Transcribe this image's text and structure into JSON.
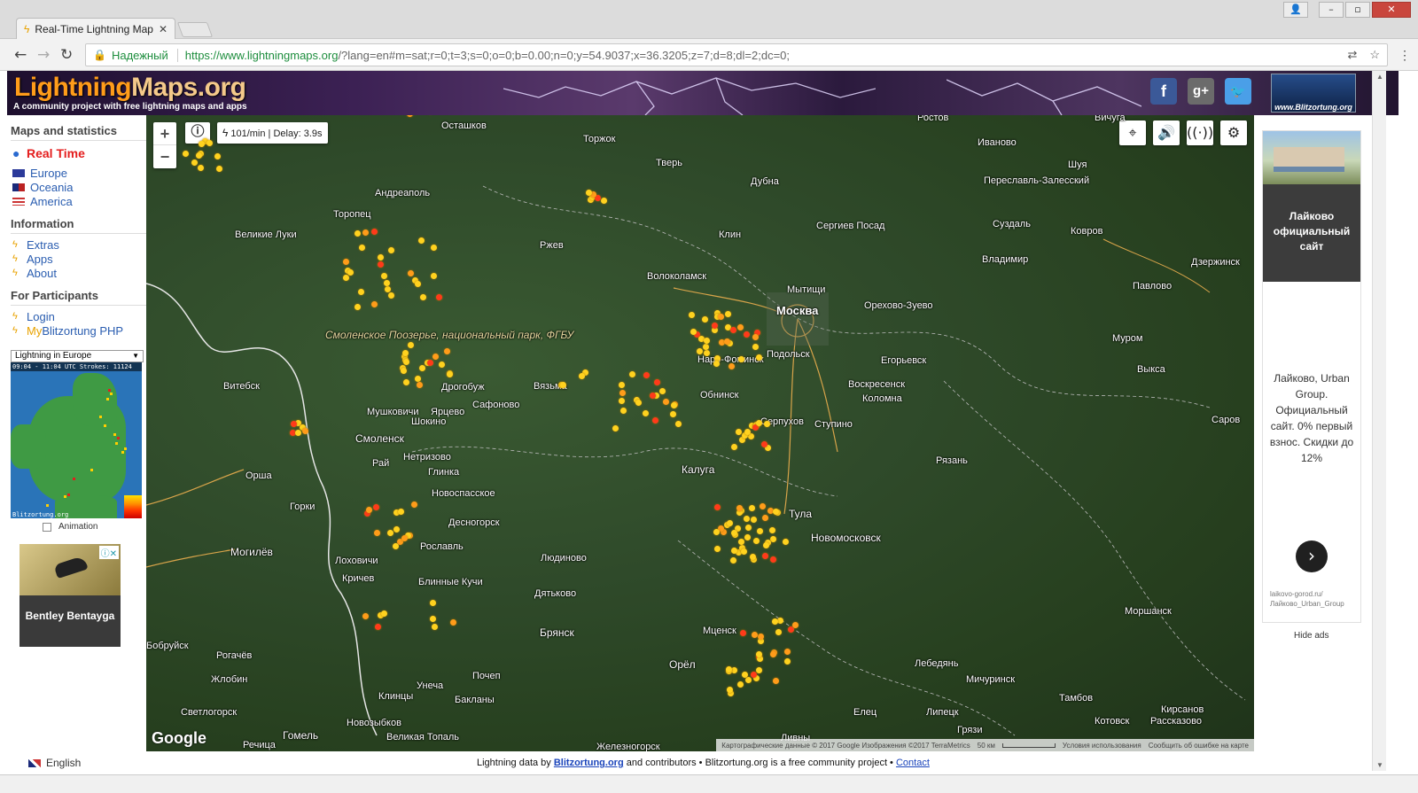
{
  "browser": {
    "tab_title": "Real-Time Lightning Map",
    "secure_label": "Надежный",
    "url_host": "https://www.lightningmaps.org",
    "url_path": "/?lang=en#m=sat;r=0;t=3;s=0;o=0;b=0.00;n=0;y=54.9037;x=36.3205;z=7;d=8;dl=2;dc=0;"
  },
  "header": {
    "logo_part1": "Lightning",
    "logo_part2": "Maps.org",
    "tagline": "A community project with free lightning maps and apps",
    "badge_text": "www.Blitzortung.org"
  },
  "sidebar": {
    "heading_maps": "Maps and statistics",
    "realtime": "Real Time",
    "regions": [
      "Europe",
      "Oceania",
      "America"
    ],
    "heading_info": "Information",
    "info_items": [
      "Extras",
      "Apps",
      "About"
    ],
    "heading_participants": "For Participants",
    "login": "Login",
    "my_prefix": "My",
    "my_suffix": "Blitzortung PHP",
    "minimap_select": "Lightning in Europe",
    "minimap_header": "09:04 - 11:04 UTC Strokes: 11124",
    "minimap_footer": "Blitzortung.org",
    "animation_label": "Animation",
    "ad_text": "Bentley Bentayga"
  },
  "map": {
    "rate": "101/min | Delay: 3.9s",
    "zoom_in": "+",
    "zoom_out": "−",
    "google": "Google",
    "attribution": "Картографические данные © 2017 Google Изображения ©2017 TerraMetrics",
    "scale": "50 км",
    "terms": "Условия использования",
    "report": "Сообщить об ошибке на карте",
    "park_label": "Смоленское Поозерье, национальный парк, ФГБУ"
  },
  "right_ad": {
    "title": "Лайково официальный сайт",
    "body": "Лайково, Urban Group. Официальный сайт. 0% первый взнос. Скидки до 12%",
    "url1": "laikovo-gorod.ru/",
    "url2": "Лайково_Urban_Group",
    "hide": "Hide ads"
  },
  "footer": {
    "language": "English",
    "credits_pre": "Lightning data by ",
    "credits_link": "Blitzortung.org",
    "credits_mid": " and contributors • Blitzortung.org is a free community project • ",
    "contact": "Contact"
  },
  "cities": [
    {
      "n": "Осташков"
    },
    {
      "n": "Торжок"
    },
    {
      "n": "Тверь"
    },
    {
      "n": "Дубна"
    },
    {
      "n": "Ростов"
    },
    {
      "n": "Иваново"
    },
    {
      "n": "Шуя"
    },
    {
      "n": "Вичуга"
    },
    {
      "n": "Андреаполь"
    },
    {
      "n": "Переславль-Залесский"
    },
    {
      "n": "Торопец"
    },
    {
      "n": "Великие Луки"
    },
    {
      "n": "Ржев"
    },
    {
      "n": "Клин"
    },
    {
      "n": "Сергиев Посад"
    },
    {
      "n": "Суздаль"
    },
    {
      "n": "Ковров"
    },
    {
      "n": "Владимир"
    },
    {
      "n": "Волоколамск"
    },
    {
      "n": "Мытищи"
    },
    {
      "n": "Москва"
    },
    {
      "n": "Орехово-Зуево"
    },
    {
      "n": "Павлово"
    },
    {
      "n": "Дзержинск"
    },
    {
      "n": "Муром"
    },
    {
      "n": "Егорьевск"
    },
    {
      "n": "Выкса"
    },
    {
      "n": "Наро-Фоминск"
    },
    {
      "n": "Подольск"
    },
    {
      "n": "Воскресенск"
    },
    {
      "n": "Коломна"
    },
    {
      "n": "Витебск"
    },
    {
      "n": "Вязьма"
    },
    {
      "n": "Обнинск"
    },
    {
      "n": "Дрогобуж"
    },
    {
      "n": "Сафоново"
    },
    {
      "n": "Мушковичи"
    },
    {
      "n": "Ярцево"
    },
    {
      "n": "Шокино"
    },
    {
      "n": "Серпухов"
    },
    {
      "n": "Ступино"
    },
    {
      "n": "Смоленск"
    },
    {
      "n": "Саров"
    },
    {
      "n": "Рай"
    },
    {
      "n": "Нетризово"
    },
    {
      "n": "Рязань"
    },
    {
      "n": "Орша"
    },
    {
      "n": "Глинка"
    },
    {
      "n": "Калуга"
    },
    {
      "n": "Новоспасское"
    },
    {
      "n": "Горки"
    },
    {
      "n": "Десногорск"
    },
    {
      "n": "Тула"
    },
    {
      "n": "Могилёв"
    },
    {
      "n": "Рославль"
    },
    {
      "n": "Новомосковск"
    },
    {
      "n": "Лоховичи"
    },
    {
      "n": "Людиново"
    },
    {
      "n": "Кричев"
    },
    {
      "n": "Блинные Кучи"
    },
    {
      "n": "Дятьково"
    },
    {
      "n": "Моршанск"
    },
    {
      "n": "Брянск"
    },
    {
      "n": "Мценск"
    },
    {
      "n": "Бобруйск"
    },
    {
      "n": "Рогачёв"
    },
    {
      "n": "Орёл"
    },
    {
      "n": "Лебедянь"
    },
    {
      "n": "Жлобин"
    },
    {
      "n": "Почеп"
    },
    {
      "n": "Мичуринск"
    },
    {
      "n": "Унеча"
    },
    {
      "n": "Клинцы"
    },
    {
      "n": "Бакланы"
    },
    {
      "n": "Тамбов"
    },
    {
      "n": "Светлогорск"
    },
    {
      "n": "Кирсанов"
    },
    {
      "n": "Новозыбков"
    },
    {
      "n": "Елец"
    },
    {
      "n": "Липецк"
    },
    {
      "n": "Котовск"
    },
    {
      "n": "Рассказово"
    },
    {
      "n": "Речица"
    },
    {
      "n": "Гомель"
    },
    {
      "n": "Великая Топаль"
    },
    {
      "n": "Грязи"
    },
    {
      "n": "Ливны"
    },
    {
      "n": "Железногорск"
    }
  ],
  "strikes_note": "lightning strikes drawn by script"
}
